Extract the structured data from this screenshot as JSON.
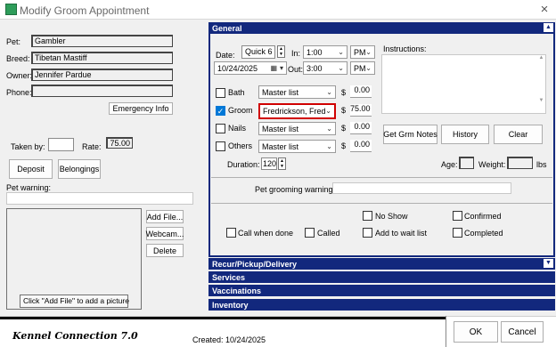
{
  "window": {
    "title": "Modify Groom Appointment",
    "close_glyph": "×"
  },
  "pet": {
    "pet_label": "Pet:",
    "pet_value": "Gambler",
    "breed_label": "Breed:",
    "breed_value": "Tibetan Mastiff",
    "owner_label": "Owner:",
    "owner_value": "Jennifer Pardue",
    "phone_label": "Phone:",
    "phone_value": ""
  },
  "left": {
    "emergency_button": "Emergency Info",
    "taken_by_label": "Taken by:",
    "taken_by_value": "",
    "rate_label": "Rate:",
    "rate_value": "75.00",
    "deposit_button": "Deposit",
    "belongings_button": "Belongings",
    "pet_warning_label": "Pet warning:",
    "pet_warning_value": "",
    "add_file_button": "Add File...",
    "webcam_button": "Webcam...",
    "delete_button": "Delete",
    "picture_hint": "Click \"Add File\" to add a picture"
  },
  "general": {
    "header": "General",
    "date_label": "Date:",
    "date_type": "Quick 6",
    "date_value": "10/24/2025",
    "in_label": "In:",
    "in_time": "1:00",
    "in_ampm": "PM",
    "out_label": "Out:",
    "out_time": "3:00",
    "out_ampm": "PM",
    "instructions_label": "Instructions:",
    "instructions_value": "",
    "services": [
      {
        "label": "Bath",
        "checked": false,
        "staff": "Master list",
        "price": "0.00"
      },
      {
        "label": "Groom",
        "checked": true,
        "staff": "Fredrickson, Fred",
        "price": "75.00"
      },
      {
        "label": "Nails",
        "checked": false,
        "staff": "Master list",
        "price": "0.00"
      },
      {
        "label": "Others",
        "checked": false,
        "staff": "Master list",
        "price": "0.00"
      }
    ],
    "currency": "$",
    "duration_label": "Duration:",
    "duration_value": "120",
    "get_grm_notes_button": "Get Grm Notes",
    "history_button": "History",
    "clear_button": "Clear",
    "age_label": "Age:",
    "age_value": "",
    "weight_label": "Weight:",
    "weight_value": "",
    "weight_unit": "lbs",
    "pet_grooming_warning_label": "Pet grooming warning:",
    "pet_grooming_warning_value": "",
    "no_show_label": "No Show",
    "confirmed_label": "Confirmed",
    "call_when_done_label": "Call when done",
    "called_label": "Called",
    "add_to_wait_list_label": "Add to wait list",
    "completed_label": "Completed"
  },
  "sections": {
    "recur": "Recur/Pickup/Delivery",
    "services": "Services",
    "vaccinations": "Vaccinations",
    "inventory": "Inventory"
  },
  "footer": {
    "brand": "Kennel Connection 7.0",
    "created_label": "Created: 10/24/2025",
    "ok_button": "OK",
    "cancel_button": "Cancel"
  },
  "colors": {
    "header_bg": "#12287d",
    "highlight": "#d00000",
    "check_blue": "#0078d7"
  },
  "icons": {
    "app": "app-icon",
    "close": "close-icon",
    "dropdown": "chevron-down-icon",
    "calendar": "calendar-icon",
    "spin": "spinner-icon"
  }
}
